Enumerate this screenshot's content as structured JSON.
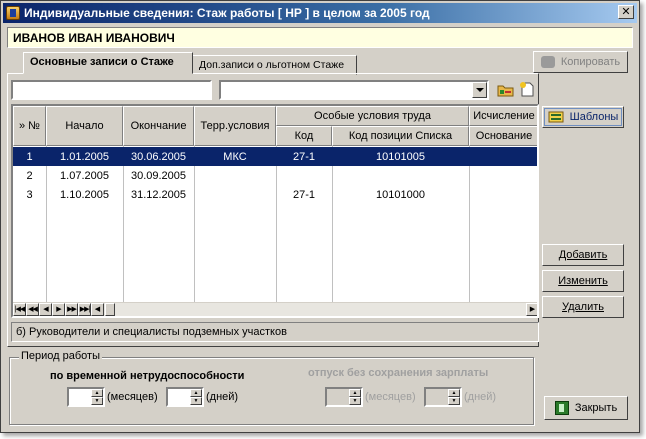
{
  "window": {
    "title": "Индивидуальные сведения: Стаж работы [ НР ] в целом за 2005 год",
    "close_glyph": "✕"
  },
  "person": {
    "name": "ИВАНОВ ИВАН ИВАНОВИЧ"
  },
  "tabs": [
    {
      "label": "Основные записи о Стаже",
      "active": true
    },
    {
      "label": "Доп.записи о льготном Стаже",
      "active": false
    }
  ],
  "toolbar": {
    "copy_label": "Копировать",
    "search_value": "",
    "filter_value": ""
  },
  "grid": {
    "headers": {
      "num": "» №",
      "start": "Начало",
      "end": "Окончание",
      "terr": "Терр.условия",
      "special_group": "Особые условия труда",
      "code": "Код",
      "position_code": "Код позиции Списка",
      "calc_group": "Исчисление",
      "basis": "Основание"
    },
    "rows": [
      {
        "num": "1",
        "start": "1.01.2005",
        "end": "30.06.2005",
        "terr": "МКС",
        "code": "27-1",
        "position_code": "10101005",
        "basis": "",
        "selected": true
      },
      {
        "num": "2",
        "start": "1.07.2005",
        "end": "30.09.2005",
        "terr": "",
        "code": "",
        "position_code": "",
        "basis": "",
        "selected": false
      },
      {
        "num": "3",
        "start": "1.10.2005",
        "end": "31.12.2005",
        "terr": "",
        "code": "27-1",
        "position_code": "10101000",
        "basis": "",
        "selected": false
      }
    ],
    "nav": {
      "first": "|◀◀",
      "prev_page": "◀◀",
      "prev": "◀",
      "next": "▶",
      "next_page": "▶▶",
      "last": "▶▶|"
    }
  },
  "info_line": "б) Руководители и специалисты подземных участков",
  "buttons": {
    "templates": "Шаблоны",
    "add": "Добавить",
    "edit": "Изменить",
    "delete": "Удалить",
    "close": "Закрыть"
  },
  "period": {
    "legend": "Период работы",
    "sick_label": "по временной нетрудоспособности",
    "unpaid_label": "отпуск без сохранения зарплаты",
    "months_unit": "(месяцев)",
    "days_unit": "(дней)",
    "sick_months": "",
    "sick_days": "",
    "unpaid_months": "",
    "unpaid_days": ""
  },
  "icons": {
    "app": "app-icon",
    "folder_add": "folder-add-icon",
    "new_doc": "new-document-icon",
    "templates": "templates-icon",
    "copy": "copy-icon",
    "close": "exit-door-icon"
  },
  "colors": {
    "title_start": "#0a246a",
    "selection": "#0a246a",
    "name_bar": "#ffffe1",
    "face": "#d4d0c8"
  }
}
